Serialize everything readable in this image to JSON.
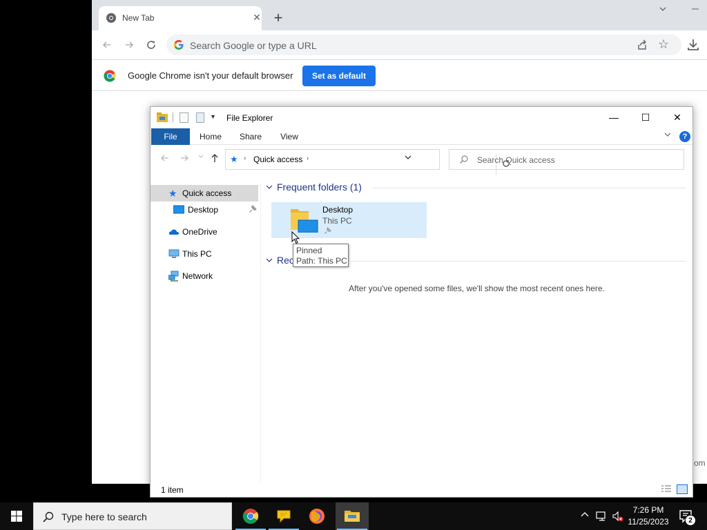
{
  "chrome": {
    "tab_title": "New Tab",
    "tab_close_glyph": "✕",
    "new_tab_glyph": "+",
    "omnibox_placeholder": "Search Google or type a URL",
    "infobar_text": "Google Chrome isn't your default browser",
    "set_default_label": "Set as default",
    "partial_link": "om"
  },
  "explorer": {
    "title": "File Explorer",
    "controls": {
      "minimize": "—",
      "maximize": "☐",
      "close": "✕"
    },
    "ribbon_tabs": [
      "File",
      "Home",
      "Share",
      "View"
    ],
    "help_glyph": "?",
    "address": {
      "location": "Quick access",
      "separator": "›"
    },
    "search_placeholder": "Search Quick access",
    "nav_pane": {
      "items": [
        {
          "label": "Quick access",
          "icon": "star-icon",
          "selected": true
        },
        {
          "label": "Desktop",
          "icon": "desktop-icon",
          "pinned": true
        },
        {
          "label": "OneDrive",
          "icon": "cloud-icon"
        },
        {
          "label": "This PC",
          "icon": "computer-icon"
        },
        {
          "label": "Network",
          "icon": "network-icon"
        }
      ]
    },
    "frequent_folders": {
      "header": "Frequent folders (1)",
      "folders": [
        {
          "name": "Desktop",
          "location": "This PC",
          "pinned": true
        }
      ]
    },
    "recent": {
      "header_visible": "Rec",
      "empty_message": "After you've opened some files, we'll show the most recent ones here."
    },
    "tooltip": {
      "line1": "Pinned",
      "line2": "Path: This PC"
    },
    "status": {
      "item_count": "1 item"
    }
  },
  "taskbar": {
    "search_placeholder": "Type here to search",
    "apps": [
      {
        "name": "Google Chrome",
        "icon": "chrome-icon",
        "running": true
      },
      {
        "name": "Messaging",
        "icon": "speech-bubble-icon",
        "running": true
      },
      {
        "name": "Firefox",
        "icon": "firefox-icon",
        "running": false
      },
      {
        "name": "File Explorer",
        "icon": "folder-icon",
        "running": true,
        "active": true
      }
    ],
    "clock": {
      "time": "7:26 PM",
      "date": "11/25/2023"
    },
    "notifications_count": "2"
  },
  "colors": {
    "chrome_accent": "#1a73e8",
    "ribbon_file_tab": "#1a5fa8",
    "explorer_header_text": "#1e3287",
    "selected_tile": "#d9ecfb",
    "taskbar": "#0e0e0e"
  }
}
